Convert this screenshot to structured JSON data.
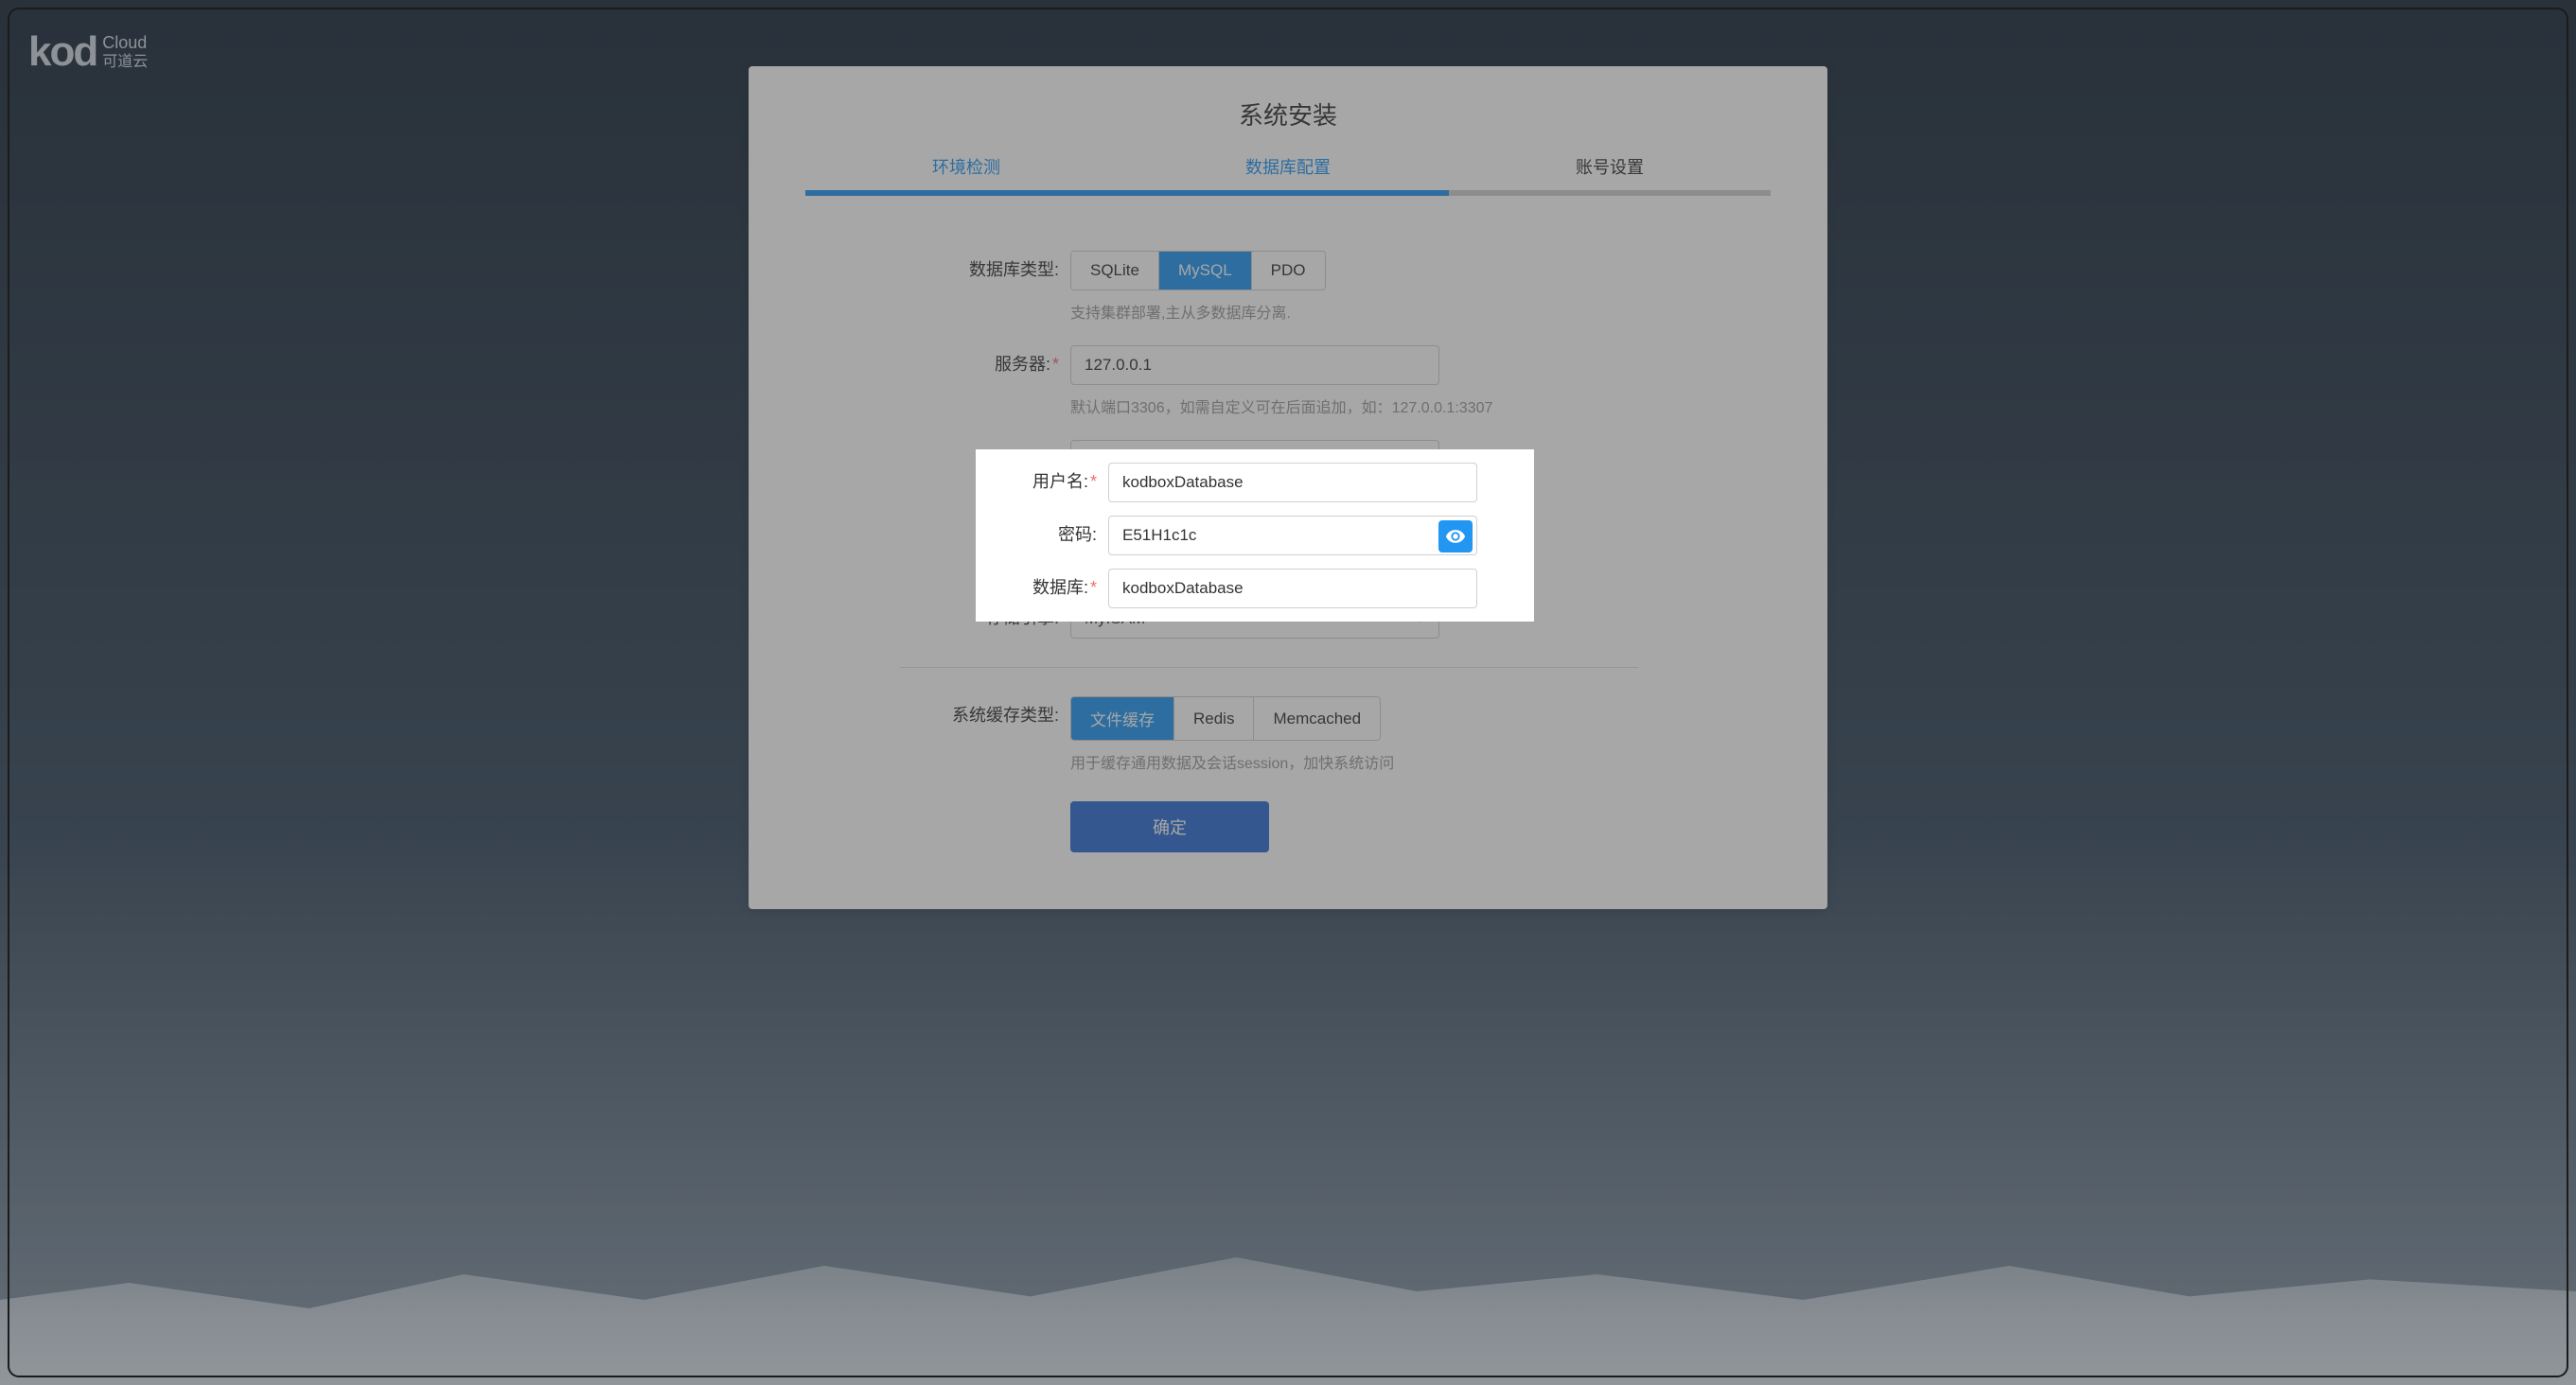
{
  "logo": {
    "main": "kod",
    "cloud": "Cloud",
    "cn": "可道云"
  },
  "panel": {
    "title": "系统安装"
  },
  "steps": [
    {
      "label": "环境检测",
      "status": "done"
    },
    {
      "label": "数据库配置",
      "status": "active"
    },
    {
      "label": "账号设置",
      "status": "pending"
    }
  ],
  "form": {
    "dbType": {
      "label": "数据库类型:",
      "options": [
        "SQLite",
        "MySQL",
        "PDO"
      ],
      "selected": "MySQL",
      "hint": "支持集群部署,主从多数据库分离."
    },
    "server": {
      "label": "服务器:",
      "value": "127.0.0.1",
      "hint": "默认端口3306，如需自定义可在后面追加，如：127.0.0.1:3307",
      "required": true
    },
    "username": {
      "label": "用户名:",
      "value": "kodboxDatabase",
      "required": true
    },
    "password": {
      "label": "密码:",
      "value": "E51H1c1c"
    },
    "database": {
      "label": "数据库:",
      "value": "kodboxDatabase",
      "required": true
    },
    "engine": {
      "label": "存储引擎:",
      "value": "MyISAM"
    },
    "cacheType": {
      "label": "系统缓存类型:",
      "options": [
        "文件缓存",
        "Redis",
        "Memcached"
      ],
      "selected": "文件缓存",
      "hint": "用于缓存通用数据及会话session，加快系统访问"
    },
    "submit": "确定"
  }
}
